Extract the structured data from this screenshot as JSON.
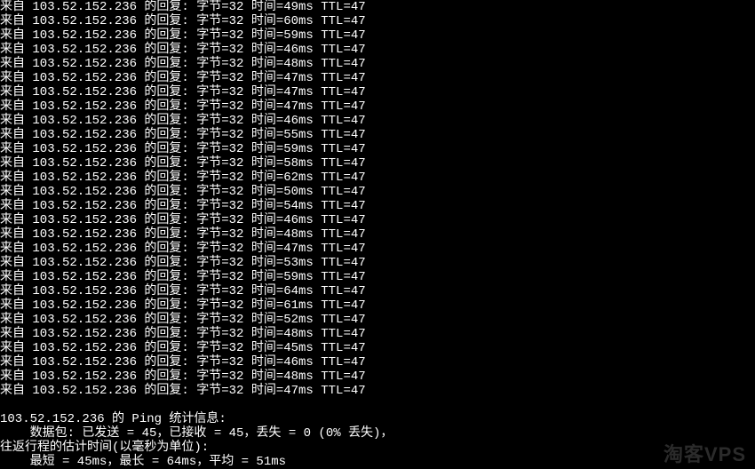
{
  "ip": "103.52.152.236",
  "bytes": 32,
  "ttl": 47,
  "replies": [
    49,
    60,
    59,
    46,
    48,
    47,
    47,
    47,
    46,
    55,
    59,
    58,
    62,
    50,
    54,
    46,
    48,
    47,
    53,
    59,
    64,
    61,
    52,
    48,
    45,
    46,
    48,
    47
  ],
  "stats_header_prefix": "103.52.152.236 的 Ping 统计信息:",
  "stats_packets": "    数据包: 已发送 = 45，已接收 = 45，丢失 = 0 (0% 丢失)，",
  "stats_rtt_header": "往返行程的估计时间(以毫秒为单位):",
  "stats_rtt_values": "    最短 = 45ms，最长 = 64ms，平均 = 51ms",
  "watermark": "淘客VPS",
  "reply_template": {
    "prefix": "来自 ",
    "reply_label": " 的回复: ",
    "bytes_label": "字节=",
    "time_label": " 时间=",
    "time_unit": "ms ",
    "ttl_label": "TTL="
  }
}
